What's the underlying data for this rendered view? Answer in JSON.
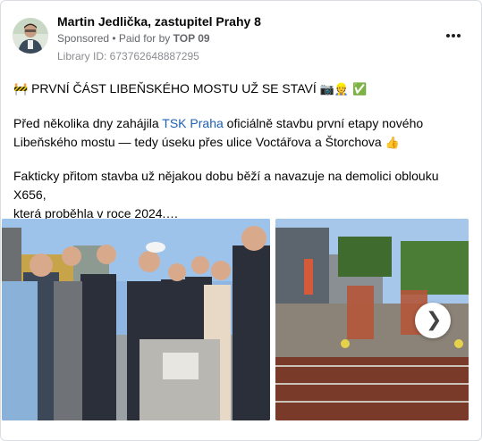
{
  "post": {
    "author": "Martin Jedlička, zastupitel Prahy 8",
    "sponsored_label": "Sponsored",
    "paid_for_prefix": " • Paid for by ",
    "payer": "TOP 09",
    "library_id": "Library ID: 673762648887295",
    "headline_icon": "🚧",
    "headline": "PRVNÍ ČÁST LIBEŇSKÉHO MOSTU UŽ SE STAVÍ",
    "headline_emojis": "📷👷 ✅",
    "para1_before": "Před několika dny zahájila ",
    "para1_link": "TSK Praha",
    "para1_line1_after": " oficiálně stavbu první etapy nového",
    "para1_line2": "Libeňského mostu — tedy úseku přes ulice Voctářova a Štorchova",
    "para1_emoji": "👍",
    "para2_line1": "Fakticky přitom stavba už nějakou dobu běží a navazuje na demolici oblouku X656,",
    "para2_line2": "která proběhla v roce 2024.…",
    "more_icon": "more-horizontal-icon",
    "next_icon": "chevron-right-icon"
  },
  "colors": {
    "link": "#1d5fb5",
    "secondary_text": "#65676b",
    "border": "#dadde1"
  }
}
